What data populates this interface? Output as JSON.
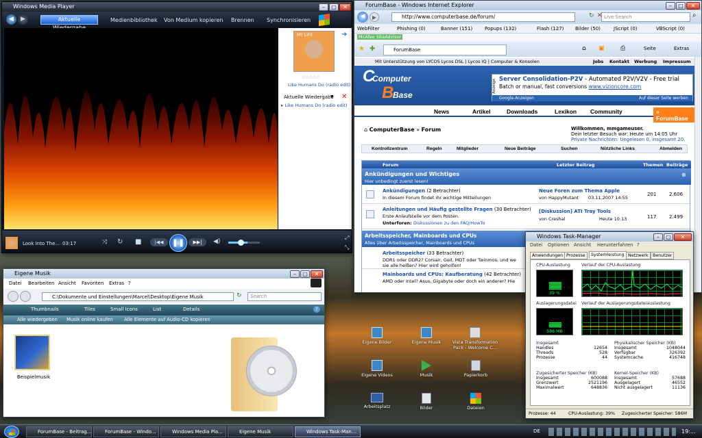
{
  "wmp": {
    "title": "Windows Media Player",
    "tabs": [
      "Aktuelle Wiedergabe",
      "Medienbibliothek",
      "Von Medium kopieren",
      "Brennen",
      "Synchronisieren"
    ],
    "album_link": "Like Humans Do (radio edit)",
    "list_title": "Aktuelle Wiedergabe",
    "list_item": "Like Humans Do (radio edit)",
    "now_playing": "Look Into The...",
    "time": "03:17",
    "album_art_label": "MY LIFE"
  },
  "ie": {
    "title": "ForumBase - Windows Internet Explorer",
    "url": "http://www.computerbase.de/forum/",
    "search_placeholder": "Live Search",
    "webfilter": [
      "WebFilter",
      "Phishing (0)",
      "Banner (151)",
      "Popups (132)",
      "Flash (127)",
      "Bilder (50)",
      "JScript (0)",
      "VBScript (0)"
    ],
    "mcafee": "McAfee SiteAdvisor",
    "tab": "ForumBase",
    "cmds": [
      "Seite",
      "Extras"
    ],
    "topbar": "Mit Unterstützung von LYCOS  Lycos DSL  |  Lycos IQ  |  Computer & Konsolen",
    "toplinks": [
      "Jobs",
      "Kontakt",
      "Werbung",
      "Impressum"
    ],
    "logo": [
      "Computer",
      "Base"
    ],
    "ad": {
      "title": "Server Consolidation-P2V",
      "title_rest": " - Automated P2V/V2V - Free trial",
      "line2": "Batch or manual, fast conversions ",
      "url": "www.vizioncore.com",
      "side": "Anzeige",
      "google": "Google-Anzeigen",
      "own": "Auf dieser Seite werben"
    },
    "nav": [
      "News",
      "Artikel",
      "Downloads",
      "Lexikon",
      "Community",
      "» ForumBase"
    ],
    "crumb": [
      "ComputerBase",
      "Forum"
    ],
    "welcome": {
      "title": "Willkommen, mmgameuser.",
      "l1": "Dein letzter Besuch war: Heute um 14:05 Uhr",
      "l2": "Private Nachrichten: Ungelesen 0, insgesamt 20."
    },
    "menu": [
      "Kontrollzentrum",
      "Regeln",
      "Mitglieder",
      "Neue Beiträge",
      "Suchen",
      "Nützliche Links",
      "Abmelden"
    ],
    "thead": [
      "Forum",
      "Letzter Beitrag",
      "Themen",
      "Beiträge"
    ],
    "sec1": {
      "title": "Ankündigungen und Wichtiges",
      "sub": "Hier unbedingt zuerst lesen!"
    },
    "rows": [
      {
        "name": "Ankündigungen",
        "count": "(2 Betrachter)",
        "desc": "In diesem Forum findet ihr wichtige Mitteilungen",
        "last": "Neue Foren zum Thema Apple",
        "by": "von HappyMutant",
        "date": "03.11.2007 14:55",
        "themen": "201",
        "beitraege": "2.606"
      },
      {
        "name": "Anleitungen und Häufig gestellte Fragen",
        "count": "(30 Betrachter)",
        "desc": "Erste Anlaufstelle vor dem Posten.",
        "sub": "Unterforen:",
        "subf": "Diskussionen zu den FAQ/HowTo",
        "last": "[Diskussion] ATI Tray Tools",
        "by": "von Creshal",
        "date": "Heute 10:13",
        "themen": "117",
        "beitraege": "2.499"
      }
    ],
    "sec2": {
      "title": "Arbeitsspeicher, Mainboards und CPUs",
      "sub": "Alles über Arbeitsspeicher, Mainboards und CPUs"
    },
    "rows2": [
      {
        "name": "Arbeitsspeicher",
        "count": "(33 Betrachter)",
        "desc": "DDR1 oder DDR2? Corsair, Geil, MDT oder Twinmos, und we",
        "desc2": "sie alle heißen? Hier wird geholfen!"
      },
      {
        "name": "Mainboards und CPUs: Kaufberatung",
        "count": "(42 Betrachter)",
        "desc": "AMD oder Intel? Asus, Gigabyte oder doch ein anderer? Hie"
      }
    ]
  },
  "tm": {
    "title": "Windows Task-Manager",
    "menu": [
      "Datei",
      "Optionen",
      "Ansicht",
      "Herunterfahren",
      "?"
    ],
    "tabs": [
      "Anwendungen",
      "Prozesse",
      "Systemleistung",
      "Netzwerk",
      "Benutzer"
    ],
    "cpu_label": "CPU-Auslastung",
    "cpu_val": "39 %",
    "cpu_pct": 39,
    "cpu_hist": "Verlauf der CPU-Auslastung",
    "page_label": "Auslagerungsdatei",
    "page_val": "586 MB",
    "page_pct": 30,
    "page_hist": "Verlauf der Auslagerungsdateiauslastung",
    "g1": {
      "title": "Insgesamt",
      "rows": [
        [
          "Handles",
          "12654"
        ],
        [
          "Threads",
          "528"
        ],
        [
          "Prozesse",
          "44"
        ]
      ]
    },
    "g2": {
      "title": "Physikalischer Speicher (KB)",
      "rows": [
        [
          "Insgesamt",
          "1048044"
        ],
        [
          "Verfügbar",
          "326392"
        ],
        [
          "Systemcache",
          "416748"
        ]
      ]
    },
    "g3": {
      "title": "Zugesicherter Speicher (KB)",
      "rows": [
        [
          "Insgesamt",
          "600088"
        ],
        [
          "Grenzwert",
          "2521196"
        ],
        [
          "Maximalwert",
          "648836"
        ]
      ]
    },
    "g4": {
      "title": "Kernel-Speicher (KB)",
      "rows": [
        [
          "Insgesamt",
          "57688"
        ],
        [
          "Ausgelagert",
          "46552"
        ],
        [
          "Nicht ausgelagert",
          "11136"
        ]
      ]
    },
    "status": [
      "Prozesse: 44",
      "CPU-Auslastung: 39%",
      "Zugesicherter Speicher: 586M"
    ]
  },
  "ex": {
    "title": "Eigene Musik",
    "menu": [
      "Datei",
      "Bearbeiten",
      "Ansicht",
      "Favoriten",
      "Extras",
      "?"
    ],
    "path": "C:\\Dokumente und Einstellungen\\Marcel\\Desktop\\Eigene Musik",
    "search": "Search",
    "views": [
      "Thumbnails",
      "Tiles",
      "Small Icons",
      "List",
      "Details"
    ],
    "tasks": [
      "Alle wiedergeben",
      "Musik online kaufen",
      "Alle Elemente auf Audio-CD kopieren"
    ],
    "file": "Beispielmusik"
  },
  "desk": [
    {
      "l": "Eigene Bilder"
    },
    {
      "l": "Eigene Musik"
    },
    {
      "l": "Vista Transformation Pack - Welcome C..."
    },
    {
      "l": "Eigene Videos"
    },
    {
      "l": "Musik"
    },
    {
      "l": "Papierkorb"
    },
    {
      "l": "Arbeitsplatz"
    },
    {
      "l": "Bilder"
    },
    {
      "l": "Dateien"
    }
  ],
  "taskbar": {
    "items": [
      "ForumBase - Beitrag...",
      "ForumBase - Windo...",
      "Windows Media Pla...",
      "Eigene Musik",
      "Windows Task-Man..."
    ],
    "tray": "DE",
    "clock": "19:..."
  },
  "colors": {
    "accent": "#1b5ed6",
    "cb_blue": "#1f4f9c",
    "cb_orange": "#ff7f1a",
    "graph": "#00ff44"
  }
}
